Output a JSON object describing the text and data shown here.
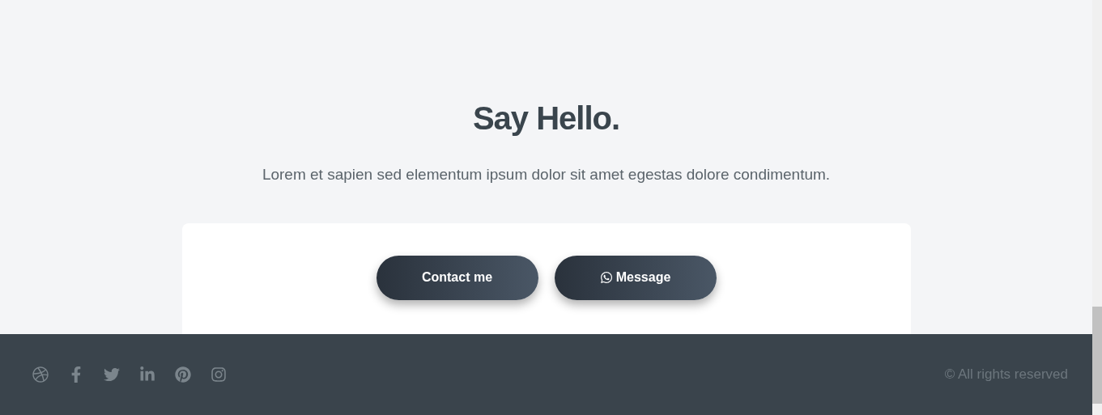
{
  "heading": "Say Hello.",
  "intro": "Lorem et sapien sed elementum ipsum dolor sit amet egestas dolore condimentum.",
  "buttons": [
    {
      "label": "Contact me",
      "kind": "plain"
    },
    {
      "label": "Message",
      "kind": "chat"
    }
  ],
  "footer": {
    "social": [
      {
        "kind": "dribbble"
      },
      {
        "kind": "facebook"
      },
      {
        "kind": "twitter"
      },
      {
        "kind": "linkedin"
      },
      {
        "kind": "pinterest"
      },
      {
        "kind": "instagram"
      }
    ],
    "copyright": "© All rights reserved"
  }
}
